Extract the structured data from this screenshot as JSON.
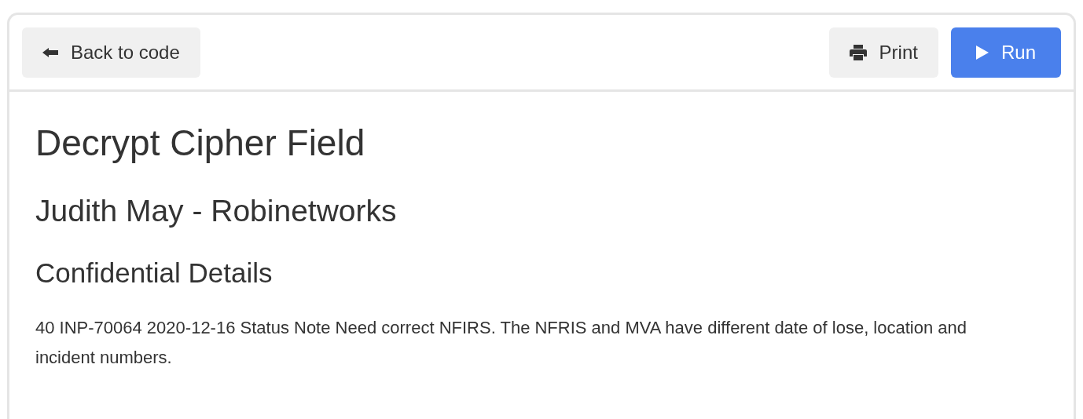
{
  "toolbar": {
    "left_buttons": [
      {
        "label": "Back to code",
        "kind": "back"
      }
    ],
    "right_buttons": [
      {
        "label": "Print",
        "kind": "print"
      },
      {
        "label": "Run",
        "kind": "run"
      }
    ]
  },
  "document": {
    "title": "Decrypt Cipher Field",
    "subtitle": "Judith May - Robinetworks",
    "section_heading": "Confidential Details",
    "paragraph": "40 INP-70064 2020-12-16 Status Note Need correct NFIRS. The NFRIS and MVA have different date of lose, location and incident numbers."
  }
}
